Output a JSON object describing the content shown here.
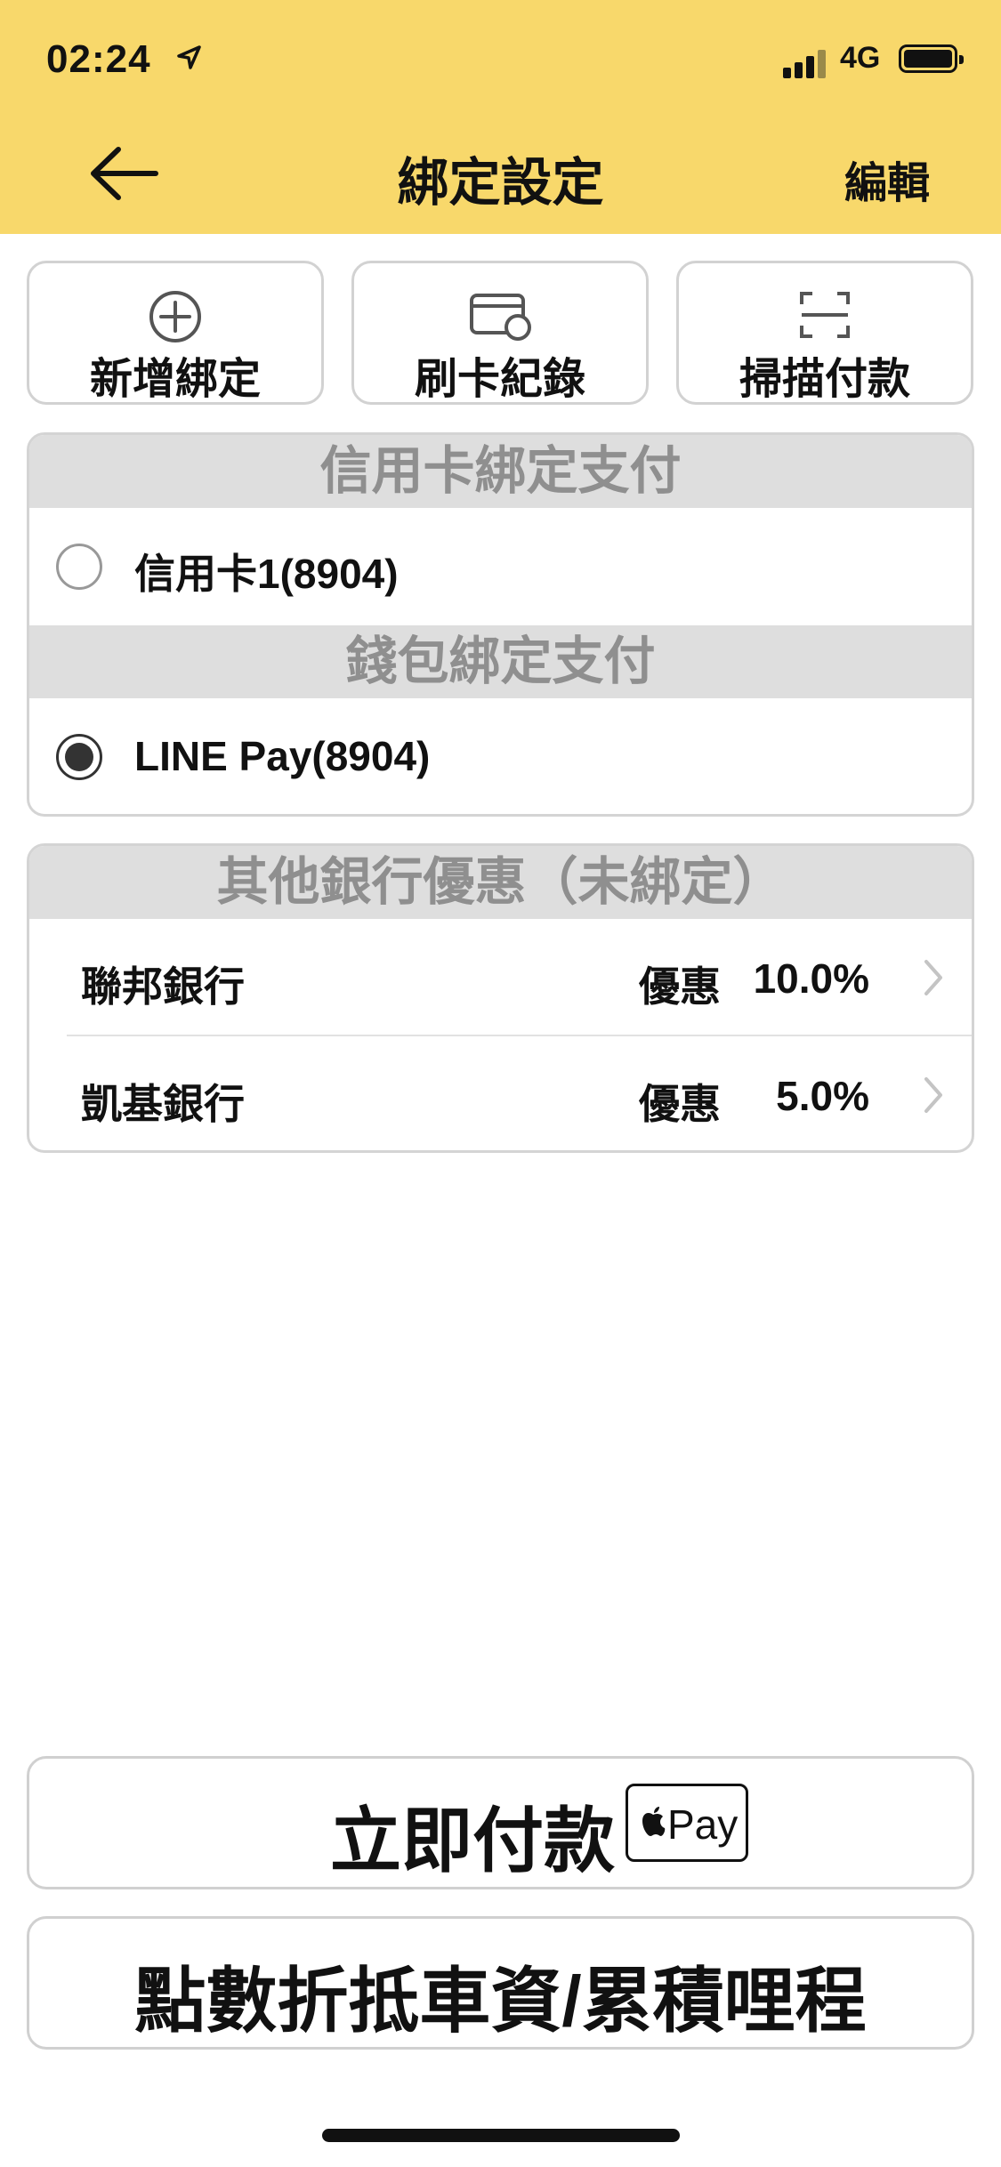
{
  "status_bar": {
    "time": "02:24",
    "network": "4G"
  },
  "header": {
    "title": "綁定設定",
    "edit_label": "編輯"
  },
  "quick_actions": [
    {
      "label": "新增綁定",
      "icon": "plus-circle-icon"
    },
    {
      "label": "刷卡紀錄",
      "icon": "card-history-icon"
    },
    {
      "label": "掃描付款",
      "icon": "scan-icon"
    }
  ],
  "binding": {
    "credit_section_title": "信用卡綁定支付",
    "credit_card_label": "信用卡1(8904)",
    "wallet_section_title": "錢包綁定支付",
    "wallet_label": "LINE Pay(8904)"
  },
  "other_banks": {
    "section_title": "其他銀行優惠（未綁定）",
    "offer_label": "優惠",
    "items": [
      {
        "name": "聯邦銀行",
        "offer": "10.0%"
      },
      {
        "name": "凱基銀行",
        "offer": "5.0%"
      }
    ]
  },
  "bottom": {
    "pay_now_label": "立即付款",
    "apple_pay_label": "Pay",
    "points_label": "點數折抵車資/累積哩程"
  }
}
